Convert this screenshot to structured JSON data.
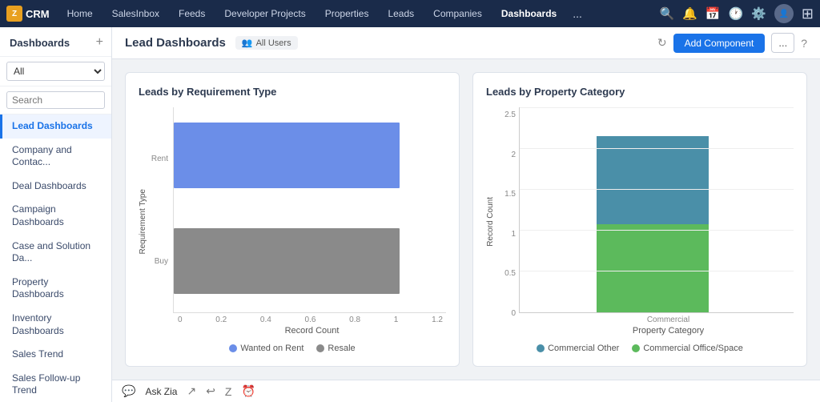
{
  "app": {
    "logo_text": "CRM",
    "nav_items": [
      {
        "label": "Home",
        "active": false
      },
      {
        "label": "SalesInbox",
        "active": false
      },
      {
        "label": "Feeds",
        "active": false
      },
      {
        "label": "Developer Projects",
        "active": false
      },
      {
        "label": "Properties",
        "active": false
      },
      {
        "label": "Leads",
        "active": false
      },
      {
        "label": "Companies",
        "active": false
      },
      {
        "label": "Dashboards",
        "active": true
      }
    ],
    "nav_more": "...",
    "icons": {
      "search": "🔍",
      "bell": "🔔",
      "calendar": "📅",
      "clock": "🕐",
      "gear": "⚙️",
      "grid": "⊞"
    }
  },
  "sidebar": {
    "title": "Dashboards",
    "add_button_label": "+",
    "filter_options": [
      "All"
    ],
    "filter_selected": "All",
    "search_placeholder": "Search",
    "nav_items": [
      {
        "label": "Lead Dashboards",
        "active": true
      },
      {
        "label": "Company and Contac...",
        "active": false
      },
      {
        "label": "Deal Dashboards",
        "active": false
      },
      {
        "label": "Campaign Dashboards",
        "active": false
      },
      {
        "label": "Case and Solution Da...",
        "active": false
      },
      {
        "label": "Property Dashboards",
        "active": false
      },
      {
        "label": "Inventory Dashboards",
        "active": false
      },
      {
        "label": "Sales Trend",
        "active": false
      },
      {
        "label": "Sales Follow-up Trend",
        "active": false
      }
    ]
  },
  "content": {
    "header_title": "Lead Dashboards",
    "all_users_label": "All Users",
    "add_component_label": "Add Component",
    "more_label": "...",
    "help_label": "?"
  },
  "chart1": {
    "title": "Leads by Requirement Type",
    "y_labels": [
      "Rent",
      "Buy"
    ],
    "x_labels": [
      "0",
      "0.2",
      "0.4",
      "0.6",
      "0.8",
      "1",
      "1.2"
    ],
    "x_axis_title": "Record Count",
    "y_axis_title": "Requirement Type",
    "bars": [
      {
        "label": "Rent",
        "color": "#6b8ee8",
        "width_pct": 83
      },
      {
        "label": "Buy",
        "color": "#8a8a8a",
        "width_pct": 83
      }
    ],
    "legend": [
      {
        "label": "Wanted on Rent",
        "color": "#6b8ee8"
      },
      {
        "label": "Resale",
        "color": "#8a8a8a"
      }
    ]
  },
  "chart2": {
    "title": "Leads by Property Category",
    "y_labels": [
      "0",
      "0.5",
      "1",
      "1.5",
      "2",
      "2.5"
    ],
    "x_label": "Commercial",
    "x_axis_title": "Property Category",
    "y_axis_title": "Record Count",
    "stacked_bars": [
      {
        "category": "Commercial",
        "segments": [
          {
            "label": "Commercial Other",
            "color": "#4a8fa8",
            "height_pct": 50
          },
          {
            "label": "Commercial Office/Space",
            "color": "#5cba5c",
            "height_pct": 50
          }
        ]
      }
    ],
    "legend": [
      {
        "label": "Commercial Other",
        "color": "#4a8fa8"
      },
      {
        "label": "Commercial Office/Space",
        "color": "#5cba5c"
      }
    ]
  },
  "bottom_bar": {
    "ask_zia_label": "Ask Zia"
  }
}
